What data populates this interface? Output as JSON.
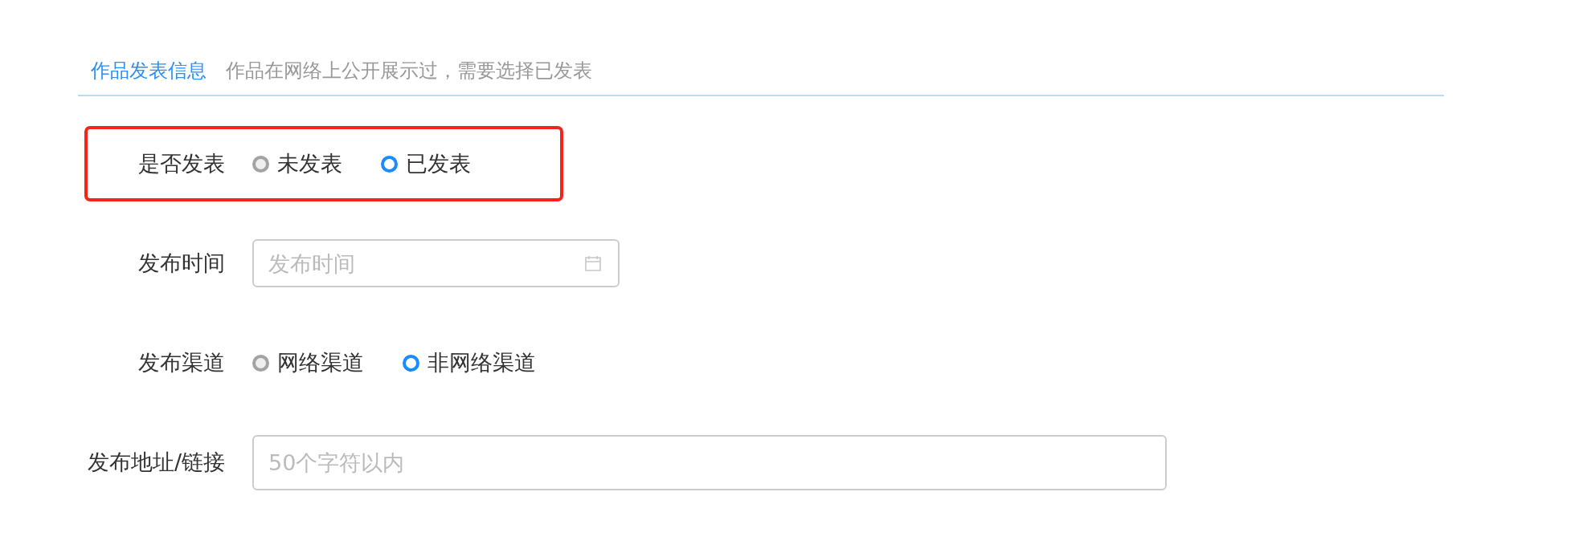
{
  "section": {
    "title": "作品发表信息",
    "note": "作品在网络上公开展示过，需要选择已发表"
  },
  "fields": [
    {
      "kind": "radio",
      "label": "是否发表",
      "highlighted": true,
      "options": [
        {
          "label": "未发表",
          "selected": false
        },
        {
          "label": "已发表",
          "selected": true
        }
      ]
    },
    {
      "kind": "date",
      "label": "发布时间",
      "highlighted": false,
      "placeholder": "发布时间"
    },
    {
      "kind": "radio",
      "label": "发布渠道",
      "highlighted": false,
      "options": [
        {
          "label": "网络渠道",
          "selected": false
        },
        {
          "label": "非网络渠道",
          "selected": true
        }
      ]
    },
    {
      "kind": "text",
      "label": "发布地址/链接",
      "highlighted": false,
      "placeholder": "50个字符以内"
    }
  ]
}
